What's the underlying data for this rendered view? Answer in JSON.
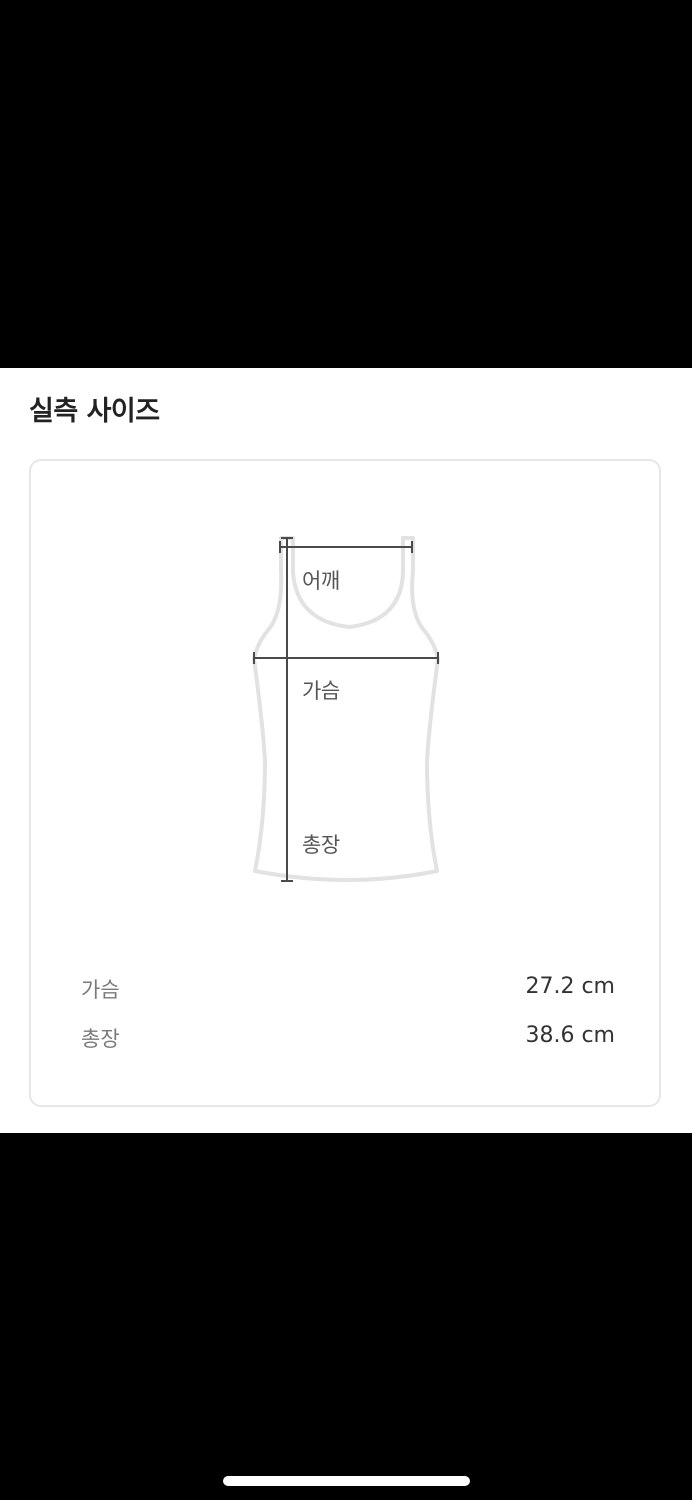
{
  "section": {
    "title": "실측 사이즈"
  },
  "diagram": {
    "icon": "tank-top-icon",
    "labels": {
      "shoulder": "어깨",
      "chest": "가슴",
      "length": "총장"
    }
  },
  "measurements": [
    {
      "label": "가슴",
      "value": "27.2 cm"
    },
    {
      "label": "총장",
      "value": "38.6 cm"
    }
  ],
  "colors": {
    "outline": "#e2e2e2",
    "measure_line": "#4a4a4a",
    "card_border": "#e6e6e6"
  }
}
